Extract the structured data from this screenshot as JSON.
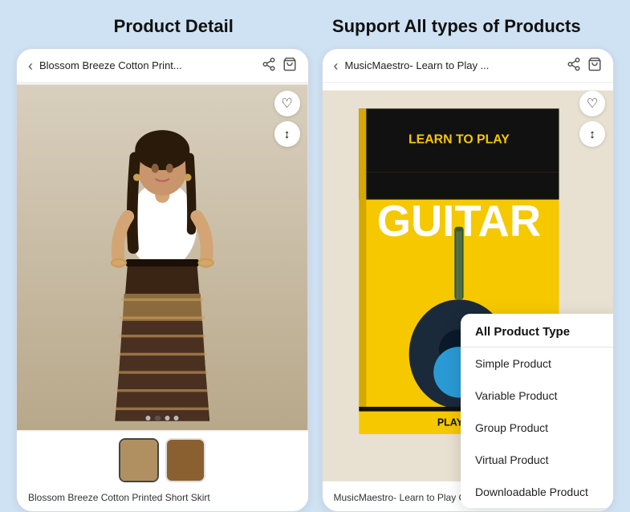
{
  "left_section": {
    "title": "Product Detail",
    "topbar": {
      "back_label": "‹",
      "product_title": "Blossom Breeze Cotton Print...",
      "share_icon": "share",
      "bag_icon": "bag"
    },
    "wishlist_icon": "♡",
    "compare_icon": "↕",
    "dots": [
      "inactive",
      "active",
      "inactive",
      "inactive"
    ],
    "thumbnails": [
      "thumb1",
      "thumb2"
    ],
    "product_name": "Blossom Breeze Cotton Printed Short Skirt"
  },
  "right_section": {
    "title": "Support All types of Products",
    "topbar": {
      "back_label": "‹",
      "product_title": "MusicMaestro- Learn to Play ...",
      "share_icon": "share",
      "bag_icon": "bag"
    },
    "wishlist_icon": "♡",
    "compare_icon": "↕",
    "product_name": "MusicMaestro- Learn to Play Guitar A Step-by",
    "dropdown": {
      "header": "All Product Type",
      "items": [
        "Simple Product",
        "Variable Product",
        "Group Product",
        "Virtual Product",
        "Downloadable Product"
      ]
    }
  }
}
